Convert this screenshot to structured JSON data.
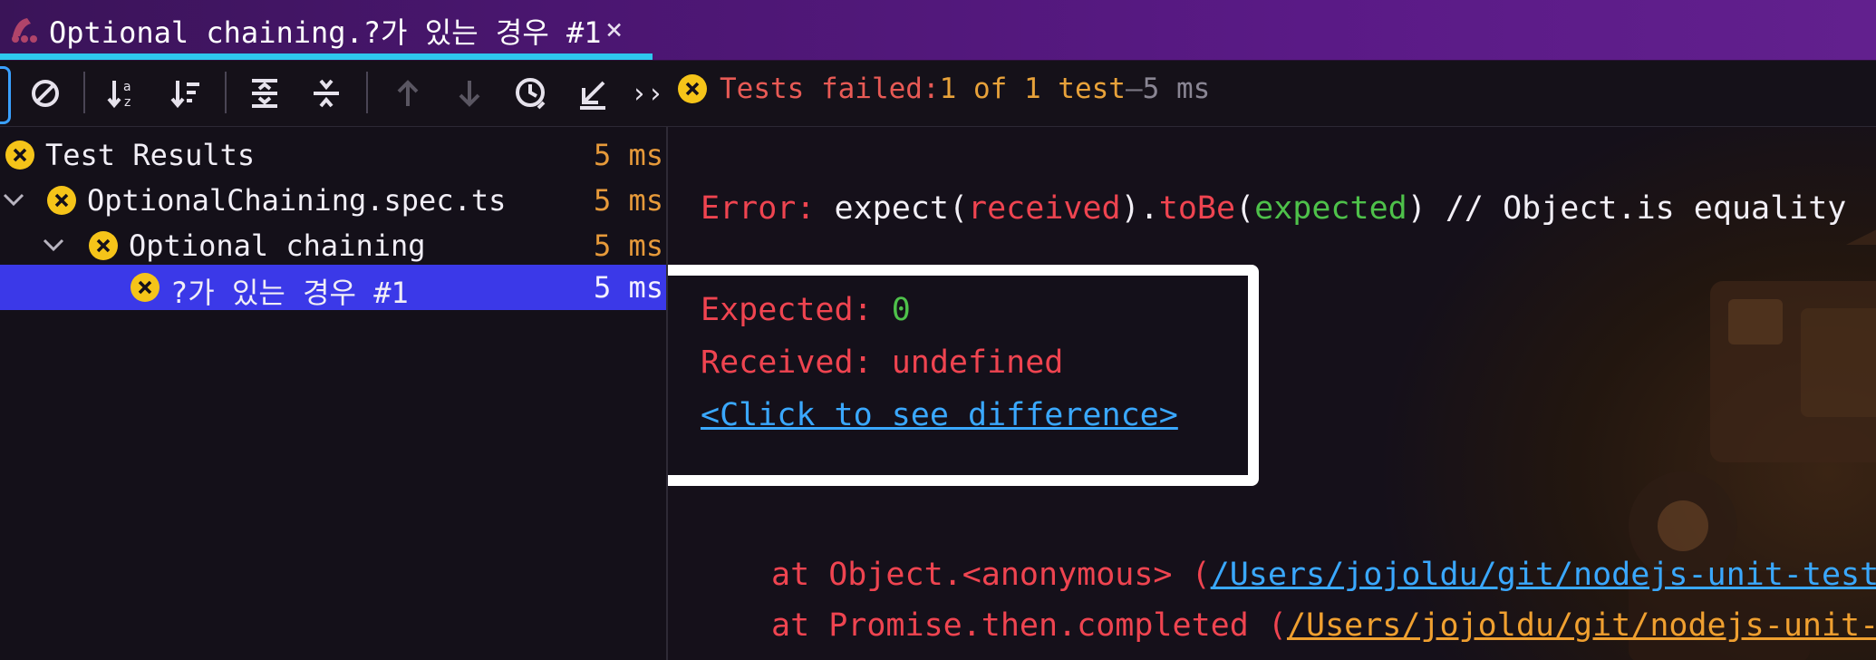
{
  "tab": {
    "title": "Optional chaining.?가 있는 경우 #1",
    "close_glyph": "×"
  },
  "toolbar": {
    "icons": [
      "stop-icon",
      "sort-alpha-icon",
      "sort-duration-icon",
      "expand-all-icon",
      "collapse-all-icon",
      "prev-failed-icon",
      "next-failed-icon",
      "history-icon",
      "import-icon"
    ],
    "more_glyph": "››",
    "status": {
      "label": "Tests failed: ",
      "count": "1 of 1 test",
      "dash": " – ",
      "duration": "5 ms"
    }
  },
  "tree": {
    "rows": [
      {
        "label": "Test Results",
        "duration": "5 ms",
        "selected": false
      },
      {
        "label": "OptionalChaining.spec.ts",
        "duration": "5 ms",
        "selected": false
      },
      {
        "label": "Optional chaining",
        "duration": "5 ms",
        "selected": false
      },
      {
        "label": "?가 있는 경우 #1",
        "duration": "5 ms",
        "selected": true
      }
    ]
  },
  "console": {
    "error": {
      "prefix": "Error: ",
      "expect": "expect(",
      "received": "received",
      "close_dot": ").",
      "tobe": "toBe",
      "open": "(",
      "expected": "expected",
      "tail": ") // Object.is equality"
    },
    "expected_label": "Expected: ",
    "expected_value": "0",
    "received_label": "Received: ",
    "received_value": "undefined",
    "diff_link": "<Click to see difference>",
    "stack": [
      {
        "at": "at Object.<anonymous> (",
        "path": "/Users/jojoldu/git/nodejs-unit-test/te"
      },
      {
        "at": "at Promise.then.completed (",
        "path": "/Users/jojoldu/git/nodejs-unit-tes"
      }
    ]
  },
  "colors": {
    "accent": "#2ec8ee",
    "selection": "#3b39e8",
    "fail": "#f5c419",
    "error_red": "#ef4450",
    "green": "#4ec14a",
    "link": "#3aa8ff"
  }
}
